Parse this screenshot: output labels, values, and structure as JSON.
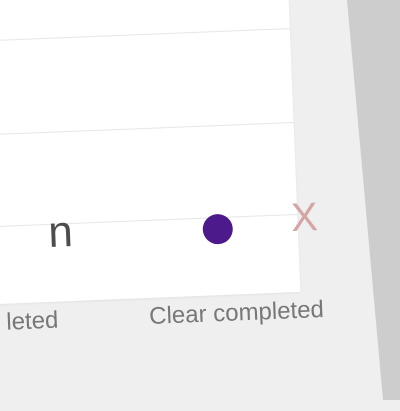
{
  "todo_item": {
    "title_fragment": "n",
    "marker_color": "#4c1a8a",
    "destroy_label": "X",
    "destroy_color": "#d4a5a5"
  },
  "footer": {
    "partial_filter_label": "leted",
    "clear_completed_label": "Clear completed"
  }
}
